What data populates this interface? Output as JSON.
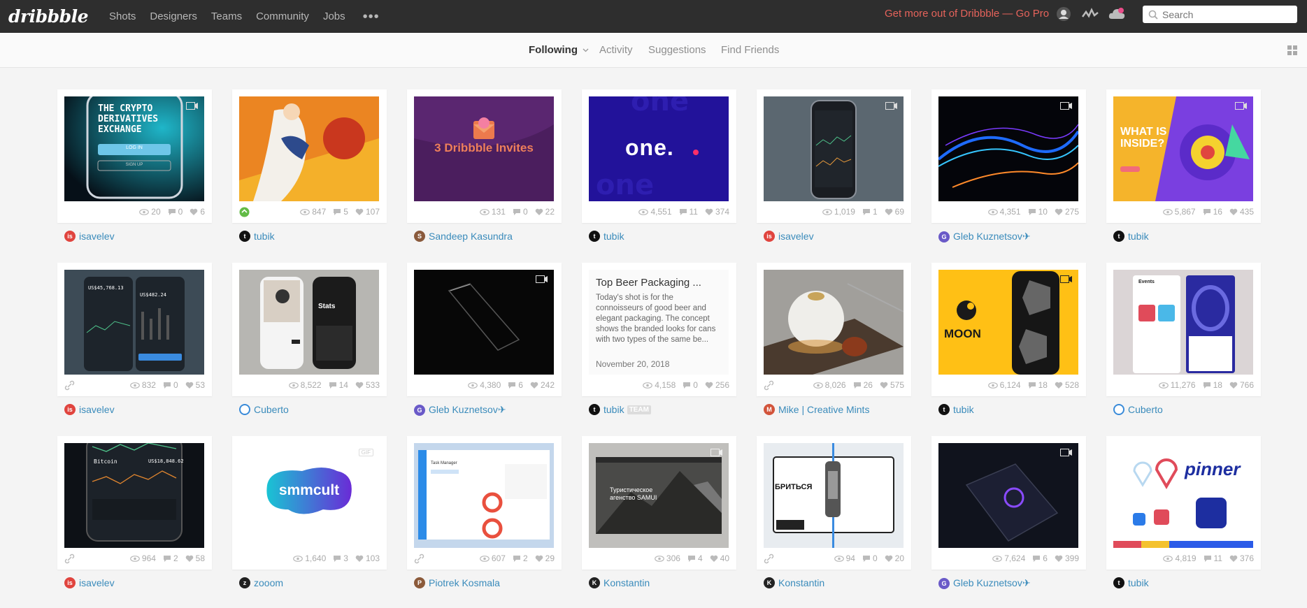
{
  "nav": {
    "logo": "dribbble",
    "links": [
      "Shots",
      "Designers",
      "Teams",
      "Community",
      "Jobs"
    ],
    "more": "•••",
    "gopro": "Get more out of Dribbble — Go Pro",
    "search_placeholder": "Search"
  },
  "subnav": {
    "following": "Following",
    "activity": "Activity",
    "suggestions": "Suggestions",
    "find_friends": "Find Friends"
  },
  "shots": [
    {
      "author": "isavelev",
      "views": "20",
      "comments": "0",
      "likes": "6",
      "thumb_text": "THE CRYPTO DERIVATIVES EXCHANGE",
      "thumb_btn": "LOG IN",
      "thumb_btn2": "SIGN UP"
    },
    {
      "author": "tubik",
      "views": "847",
      "comments": "5",
      "likes": "107"
    },
    {
      "author": "Sandeep Kasundra",
      "views": "131",
      "comments": "0",
      "likes": "22",
      "thumb_text": "3 Dribbble Invites"
    },
    {
      "author": "tubik",
      "views": "4,551",
      "comments": "11",
      "likes": "374",
      "thumb_text": "one."
    },
    {
      "author": "isavelev",
      "views": "1,019",
      "comments": "1",
      "likes": "69"
    },
    {
      "author": "Gleb Kuznetsov✈",
      "views": "4,351",
      "comments": "10",
      "likes": "275"
    },
    {
      "author": "tubik",
      "views": "5,867",
      "comments": "16",
      "likes": "435",
      "thumb_text": "WHAT IS INSIDE?"
    },
    {
      "author": "isavelev",
      "views": "832",
      "comments": "0",
      "likes": "53",
      "thumb_text": "US$45,768.13",
      "thumb_text2": "US$482.24"
    },
    {
      "author": "Cuberto",
      "views": "8,522",
      "comments": "14",
      "likes": "533",
      "thumb_text": "Stats"
    },
    {
      "author": "Gleb Kuznetsov✈",
      "views": "4,380",
      "comments": "6",
      "likes": "242"
    },
    {
      "author": "tubik",
      "team": "TEAM",
      "views": "4,158",
      "comments": "0",
      "likes": "256",
      "title": "Top Beer Packaging ...",
      "desc": "Today's shot is for the connoisseurs of good beer and elegant packaging. The concept shows the branded looks for cans with two types of the same be...",
      "date": "November 20, 2018"
    },
    {
      "author": "Mike | Creative Mints",
      "views": "8,026",
      "comments": "26",
      "likes": "575"
    },
    {
      "author": "tubik",
      "views": "6,124",
      "comments": "18",
      "likes": "528",
      "thumb_text": "MOON"
    },
    {
      "author": "Cuberto",
      "views": "11,276",
      "comments": "18",
      "likes": "766",
      "thumb_text": "Events"
    },
    {
      "author": "isavelev",
      "views": "964",
      "comments": "2",
      "likes": "58",
      "thumb_text": "Bitcoin",
      "thumb_text2": "US$18,848.62"
    },
    {
      "author": "zooom",
      "views": "1,640",
      "comments": "3",
      "likes": "103",
      "thumb_text": "smmcult",
      "badge": "GIF"
    },
    {
      "author": "Piotrek Kosmala",
      "views": "607",
      "comments": "2",
      "likes": "29",
      "thumb_text": "Task Manager"
    },
    {
      "author": "Konstantin",
      "views": "306",
      "comments": "4",
      "likes": "40",
      "thumb_text": "Туристическое агенство SAMUI"
    },
    {
      "author": "Konstantin",
      "views": "94",
      "comments": "0",
      "likes": "20",
      "thumb_text": "БРИТЬСЯ"
    },
    {
      "author": "Gleb Kuznetsov✈",
      "views": "7,624",
      "comments": "6",
      "likes": "399"
    },
    {
      "author": "tubik",
      "views": "4,819",
      "comments": "11",
      "likes": "376",
      "thumb_text": "pinner"
    }
  ]
}
